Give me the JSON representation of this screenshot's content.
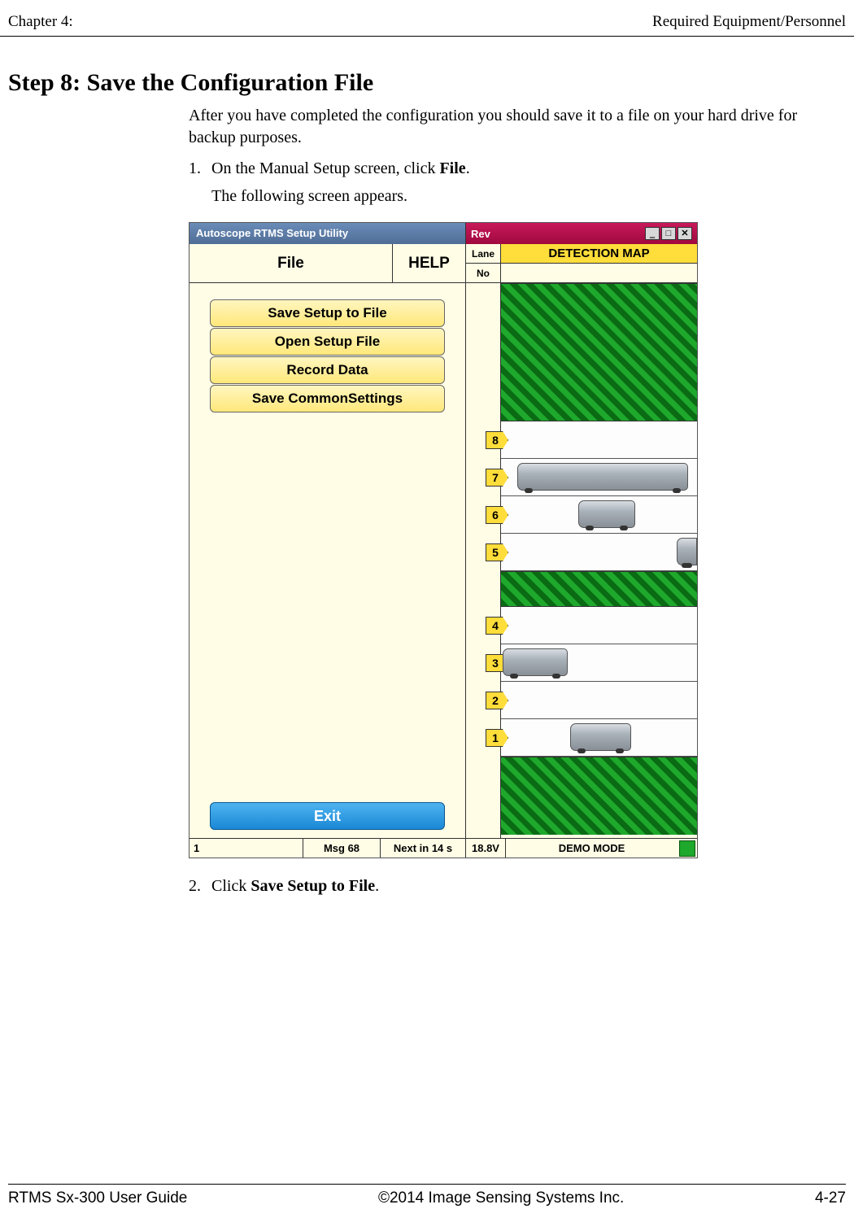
{
  "header": {
    "left": "Chapter 4:",
    "right": "Required Equipment/Personnel"
  },
  "step": {
    "title": "Step 8:  Save the Configuration File",
    "intro": "After you have completed the configuration you should save it to a file on your hard drive for backup purposes.",
    "item1_num": "1.",
    "item1_text_pre": "On the Manual Setup screen, click ",
    "item1_text_bold": "File",
    "item1_text_post": ".",
    "item1_sub": "The following screen appears.",
    "item2_num": "2.",
    "item2_text_pre": "Click ",
    "item2_text_bold": "Save Setup to File",
    "item2_text_post": "."
  },
  "app": {
    "title_left": "Autoscope RTMS Setup Utility",
    "title_right": "Rev",
    "menu": {
      "file": "File",
      "help": "HELP"
    },
    "lane_label": "Lane",
    "no_label": "No",
    "detection_map": "DETECTION MAP",
    "buttons": {
      "save_setup": "Save Setup to File",
      "open_setup": "Open Setup File",
      "record_data": "Record Data",
      "save_common": "Save CommonSettings",
      "exit": "Exit"
    },
    "lanes": [
      "8",
      "7",
      "6",
      "5",
      "4",
      "3",
      "2",
      "1"
    ],
    "status": {
      "c1": "1",
      "c2": "Msg 68",
      "c3": "Next in 14 s",
      "c4": "18.8V",
      "c5": "DEMO MODE"
    }
  },
  "footer": {
    "left": "RTMS Sx-300 User Guide",
    "center": "©2014 Image Sensing Systems Inc.",
    "right": "4-27"
  }
}
